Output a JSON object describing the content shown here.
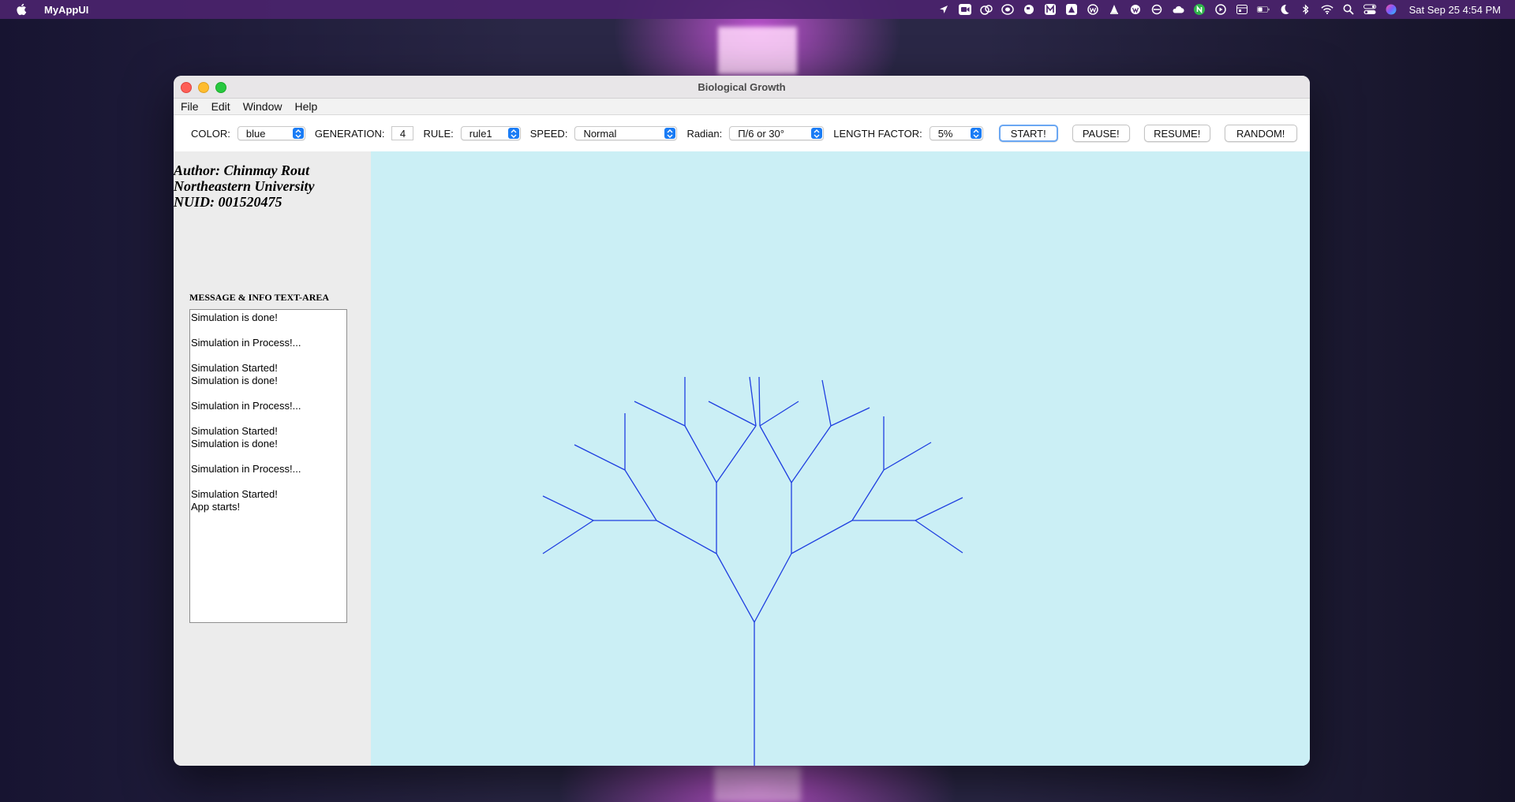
{
  "menubar": {
    "app_name": "MyAppUI",
    "clock": "Sat Sep 25  4:54 PM",
    "status_icons": [
      "location-icon",
      "zoom-icon",
      "creative-cloud-icon",
      "adobe-icon",
      "globe-icon",
      "m-icon",
      "a-icon",
      "w-icon",
      "vlc-icon",
      "wp-icon",
      "sync-icon",
      "cloud-icon",
      "n-icon",
      "play-icon",
      "calendar-icon",
      "battery-icon",
      "moon-icon",
      "bluetooth-icon",
      "wifi-icon",
      "search-icon",
      "control-center-icon",
      "siri-icon"
    ]
  },
  "window": {
    "title": "Biological Growth"
  },
  "app_menu": {
    "items": [
      "File",
      "Edit",
      "Window",
      "Help"
    ]
  },
  "toolbar": {
    "color_label": "COLOR:",
    "color_value": "blue",
    "generation_label": "GENERATION:",
    "generation_value": "4",
    "rule_label": "RULE:",
    "rule_value": "rule1",
    "speed_label": "SPEED:",
    "speed_value": "Normal",
    "radian_label": "Radian:",
    "radian_value": "Π/6 or 30°",
    "length_factor_label": "LENGTH FACTOR:",
    "length_factor_value": "5%",
    "start_label": "START!",
    "pause_label": "PAUSE!",
    "resume_label": "RESUME!",
    "random_label": "RANDOM!"
  },
  "info_panel": {
    "author_line1": "Author: Chinmay Rout",
    "author_line2": "Northeastern University",
    "author_line3": "NUID: 001520475",
    "message_label": "MESSAGE & INFO TEXT-AREA",
    "messages": "Simulation is done!\n\nSimulation in Process!...\n\nSimulation Started!\nSimulation is done!\n\nSimulation in Process!...\n\nSimulation Started!\nSimulation is done!\n\nSimulation in Process!...\n\nSimulation Started!\nApp starts!"
  },
  "canvas": {
    "background": "#cbeff5",
    "tree_color": "#1f3fe0"
  }
}
